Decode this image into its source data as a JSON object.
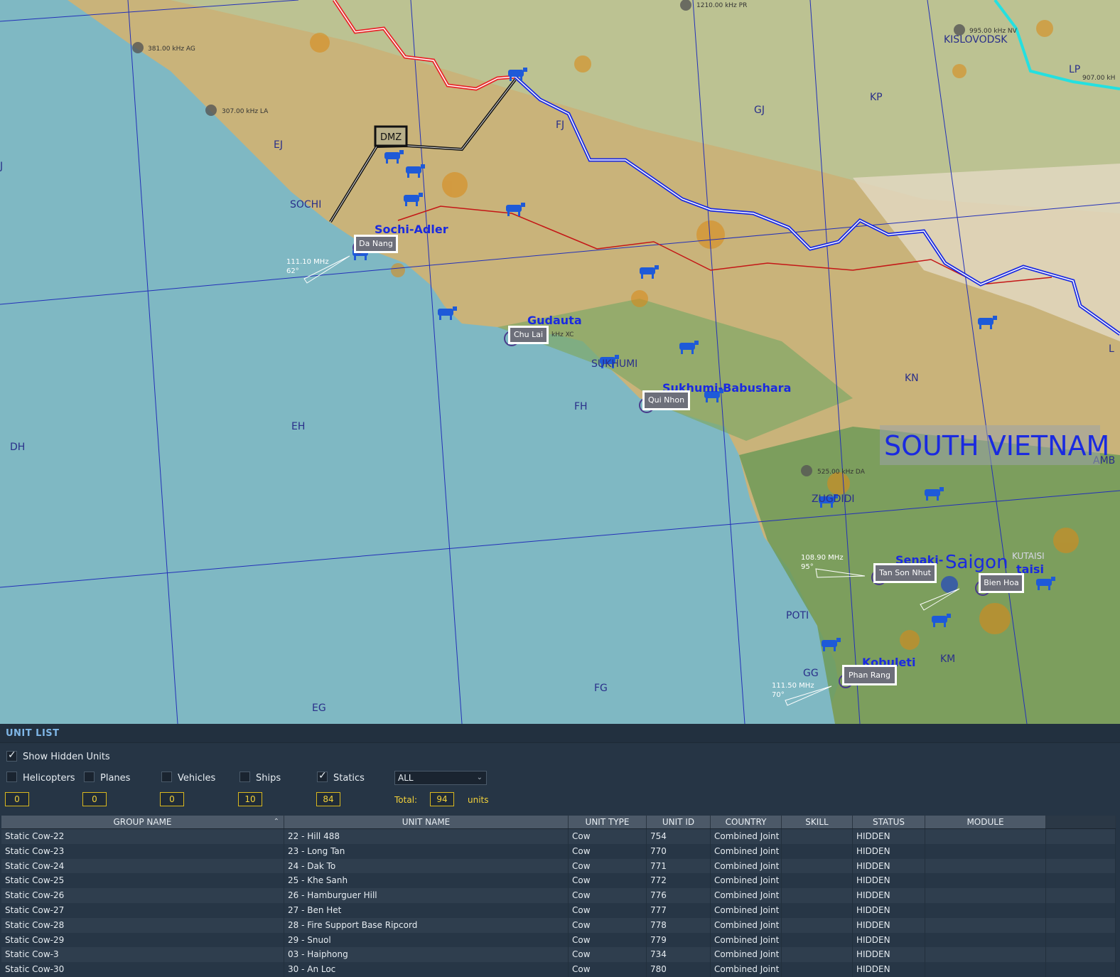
{
  "map": {
    "country_label": "SOUTH VIETNAM",
    "grid_labels": [
      "EJ",
      "J",
      "SOCHI",
      "DH",
      "EH",
      "FH",
      "FG",
      "EG",
      "GG",
      "KM",
      "KN",
      "KP",
      "GJ",
      "FJ",
      "POTI",
      "L"
    ],
    "airbases": [
      {
        "label": "Da Nang",
        "map_name": "Sochi-Adler",
        "freq": "111.10 MHz",
        "heading": "62°"
      },
      {
        "label": "Chu Lai",
        "map_name": "Gudauta",
        "freq": "kHz XC"
      },
      {
        "label": "Qui Nhon",
        "map_name": "Sukhumi-Babushara",
        "freq": ""
      },
      {
        "label": "Tan Son Nhut",
        "map_name": "Senaki-",
        "freq": "108.90 MHz",
        "heading": "95°"
      },
      {
        "label": "Bien Hoa",
        "map_name": "taisi",
        "freq": ""
      },
      {
        "label": "Phan Rang",
        "map_name": "Kobuleti",
        "freq": "111.50 MHz",
        "heading": "70°"
      }
    ],
    "city_labels": [
      "Saigon",
      "KISLOVODSK",
      "SUKHUMI",
      "ZUGDIDI",
      "KUTAISI",
      "AMB",
      "LP"
    ],
    "zone_label": "DMZ",
    "beacons": [
      "381.00 kHz AG",
      "307.00 kHz LA",
      "1210.00 kHz PR",
      "995.00 kHz NV",
      "907.00 kH",
      "525.00 kHz DA"
    ],
    "colors": {
      "sea": "#7fb8c3",
      "land": "#8fae6e",
      "border_red": "#e8262a",
      "border_blue": "#1a2ae0",
      "cow": "#1e5ad8",
      "grid": "#2330b8"
    }
  },
  "panel": {
    "title": "UNIT LIST",
    "show_hidden_label": "Show Hidden Units",
    "show_hidden_checked": true,
    "filters": [
      {
        "label": "Helicopters",
        "checked": false,
        "count": "0"
      },
      {
        "label": "Planes",
        "checked": false,
        "count": "0"
      },
      {
        "label": "Vehicles",
        "checked": false,
        "count": "0"
      },
      {
        "label": "Ships",
        "checked": false,
        "count": "10"
      },
      {
        "label": "Statics",
        "checked": true,
        "count": "84"
      }
    ],
    "coalition_select": "ALL",
    "total_label": "Total:",
    "total_value": "94",
    "units_label": "units"
  },
  "table": {
    "headers": [
      "GROUP NAME",
      "UNIT NAME",
      "UNIT TYPE",
      "UNIT ID",
      "COUNTRY",
      "SKILL",
      "STATUS",
      "MODULE",
      ""
    ],
    "rows": [
      [
        "Static Cow-22",
        "22 - Hill 488",
        "Cow",
        "754",
        "Combined Joint Ta",
        "",
        "HIDDEN",
        "",
        ""
      ],
      [
        "Static Cow-23",
        "23 - Long Tan",
        "Cow",
        "770",
        "Combined Joint Ta",
        "",
        "HIDDEN",
        "",
        ""
      ],
      [
        "Static Cow-24",
        "24 - Dak To",
        "Cow",
        "771",
        "Combined Joint Ta",
        "",
        "HIDDEN",
        "",
        ""
      ],
      [
        "Static Cow-25",
        "25 - Khe Sanh",
        "Cow",
        "772",
        "Combined Joint Ta",
        "",
        "HIDDEN",
        "",
        ""
      ],
      [
        "Static Cow-26",
        "26 - Hamburguer Hill",
        "Cow",
        "776",
        "Combined Joint Ta",
        "",
        "HIDDEN",
        "",
        ""
      ],
      [
        "Static Cow-27",
        "27 - Ben Het",
        "Cow",
        "777",
        "Combined Joint Ta",
        "",
        "HIDDEN",
        "",
        ""
      ],
      [
        "Static Cow-28",
        "28 - Fire Support Base Ripcord",
        "Cow",
        "778",
        "Combined Joint Ta",
        "",
        "HIDDEN",
        "",
        ""
      ],
      [
        "Static Cow-29",
        "29 - Snuol",
        "Cow",
        "779",
        "Combined Joint Ta",
        "",
        "HIDDEN",
        "",
        ""
      ],
      [
        "Static Cow-3",
        "03 - Haiphong",
        "Cow",
        "734",
        "Combined Joint Ta",
        "",
        "HIDDEN",
        "",
        ""
      ],
      [
        "Static Cow-30",
        "30 - An Loc",
        "Cow",
        "780",
        "Combined Joint Ta",
        "",
        "HIDDEN",
        "",
        ""
      ]
    ]
  }
}
